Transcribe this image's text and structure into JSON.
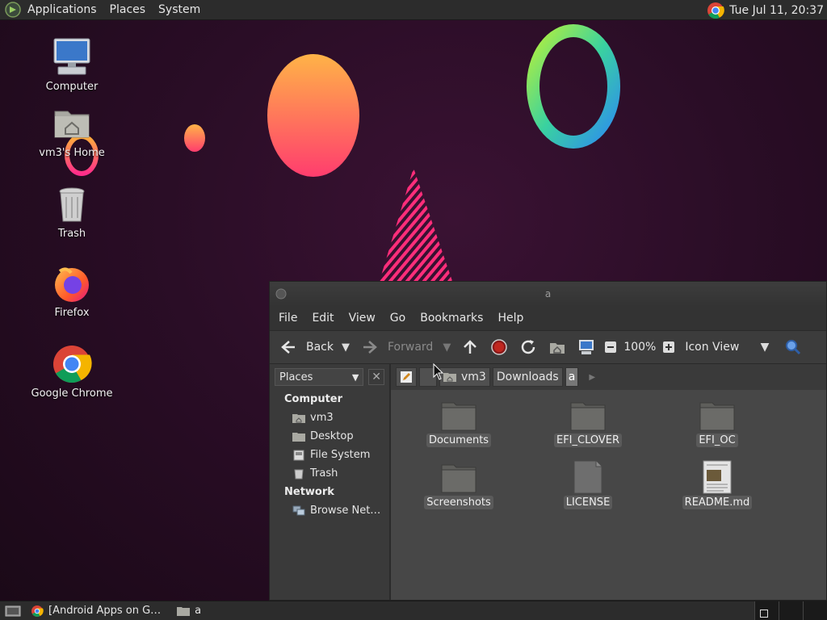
{
  "top_panel": {
    "menus": [
      "Applications",
      "Places",
      "System"
    ],
    "clock": "Tue Jul 11, 20:37"
  },
  "desktop": {
    "icons": [
      {
        "label": "Computer",
        "icon": "computer-icon"
      },
      {
        "label": "vm3's Home",
        "icon": "home-folder-icon"
      },
      {
        "label": "Trash",
        "icon": "trash-icon"
      },
      {
        "label": "Firefox",
        "icon": "firefox-icon"
      },
      {
        "label": "Google Chrome",
        "icon": "chrome-icon"
      }
    ]
  },
  "file_manager": {
    "title": "a",
    "menus": [
      "File",
      "Edit",
      "View",
      "Go",
      "Bookmarks",
      "Help"
    ],
    "toolbar": {
      "back": "Back",
      "forward": "Forward",
      "zoom": "100%",
      "view_mode": "Icon View"
    },
    "sidebar": {
      "selector": "Places",
      "sections": [
        {
          "title": "Computer",
          "items": [
            "vm3",
            "Desktop",
            "File System",
            "Trash"
          ]
        },
        {
          "title": "Network",
          "items": [
            "Browse Net…"
          ]
        }
      ]
    },
    "path": [
      "vm3",
      "Downloads",
      "a"
    ],
    "files": [
      {
        "name": "Documents",
        "type": "folder"
      },
      {
        "name": "EFI_CLOVER",
        "type": "folder"
      },
      {
        "name": "EFI_OC",
        "type": "folder"
      },
      {
        "name": "Screenshots",
        "type": "folder"
      },
      {
        "name": "LICENSE",
        "type": "file"
      },
      {
        "name": "README.md",
        "type": "document"
      }
    ]
  },
  "taskbar": {
    "tasks": [
      "[Android Apps on G…",
      "a"
    ]
  },
  "colors": {
    "panel": "#2c2c2c",
    "window": "#3a3a3a",
    "file_area": "#474747"
  }
}
